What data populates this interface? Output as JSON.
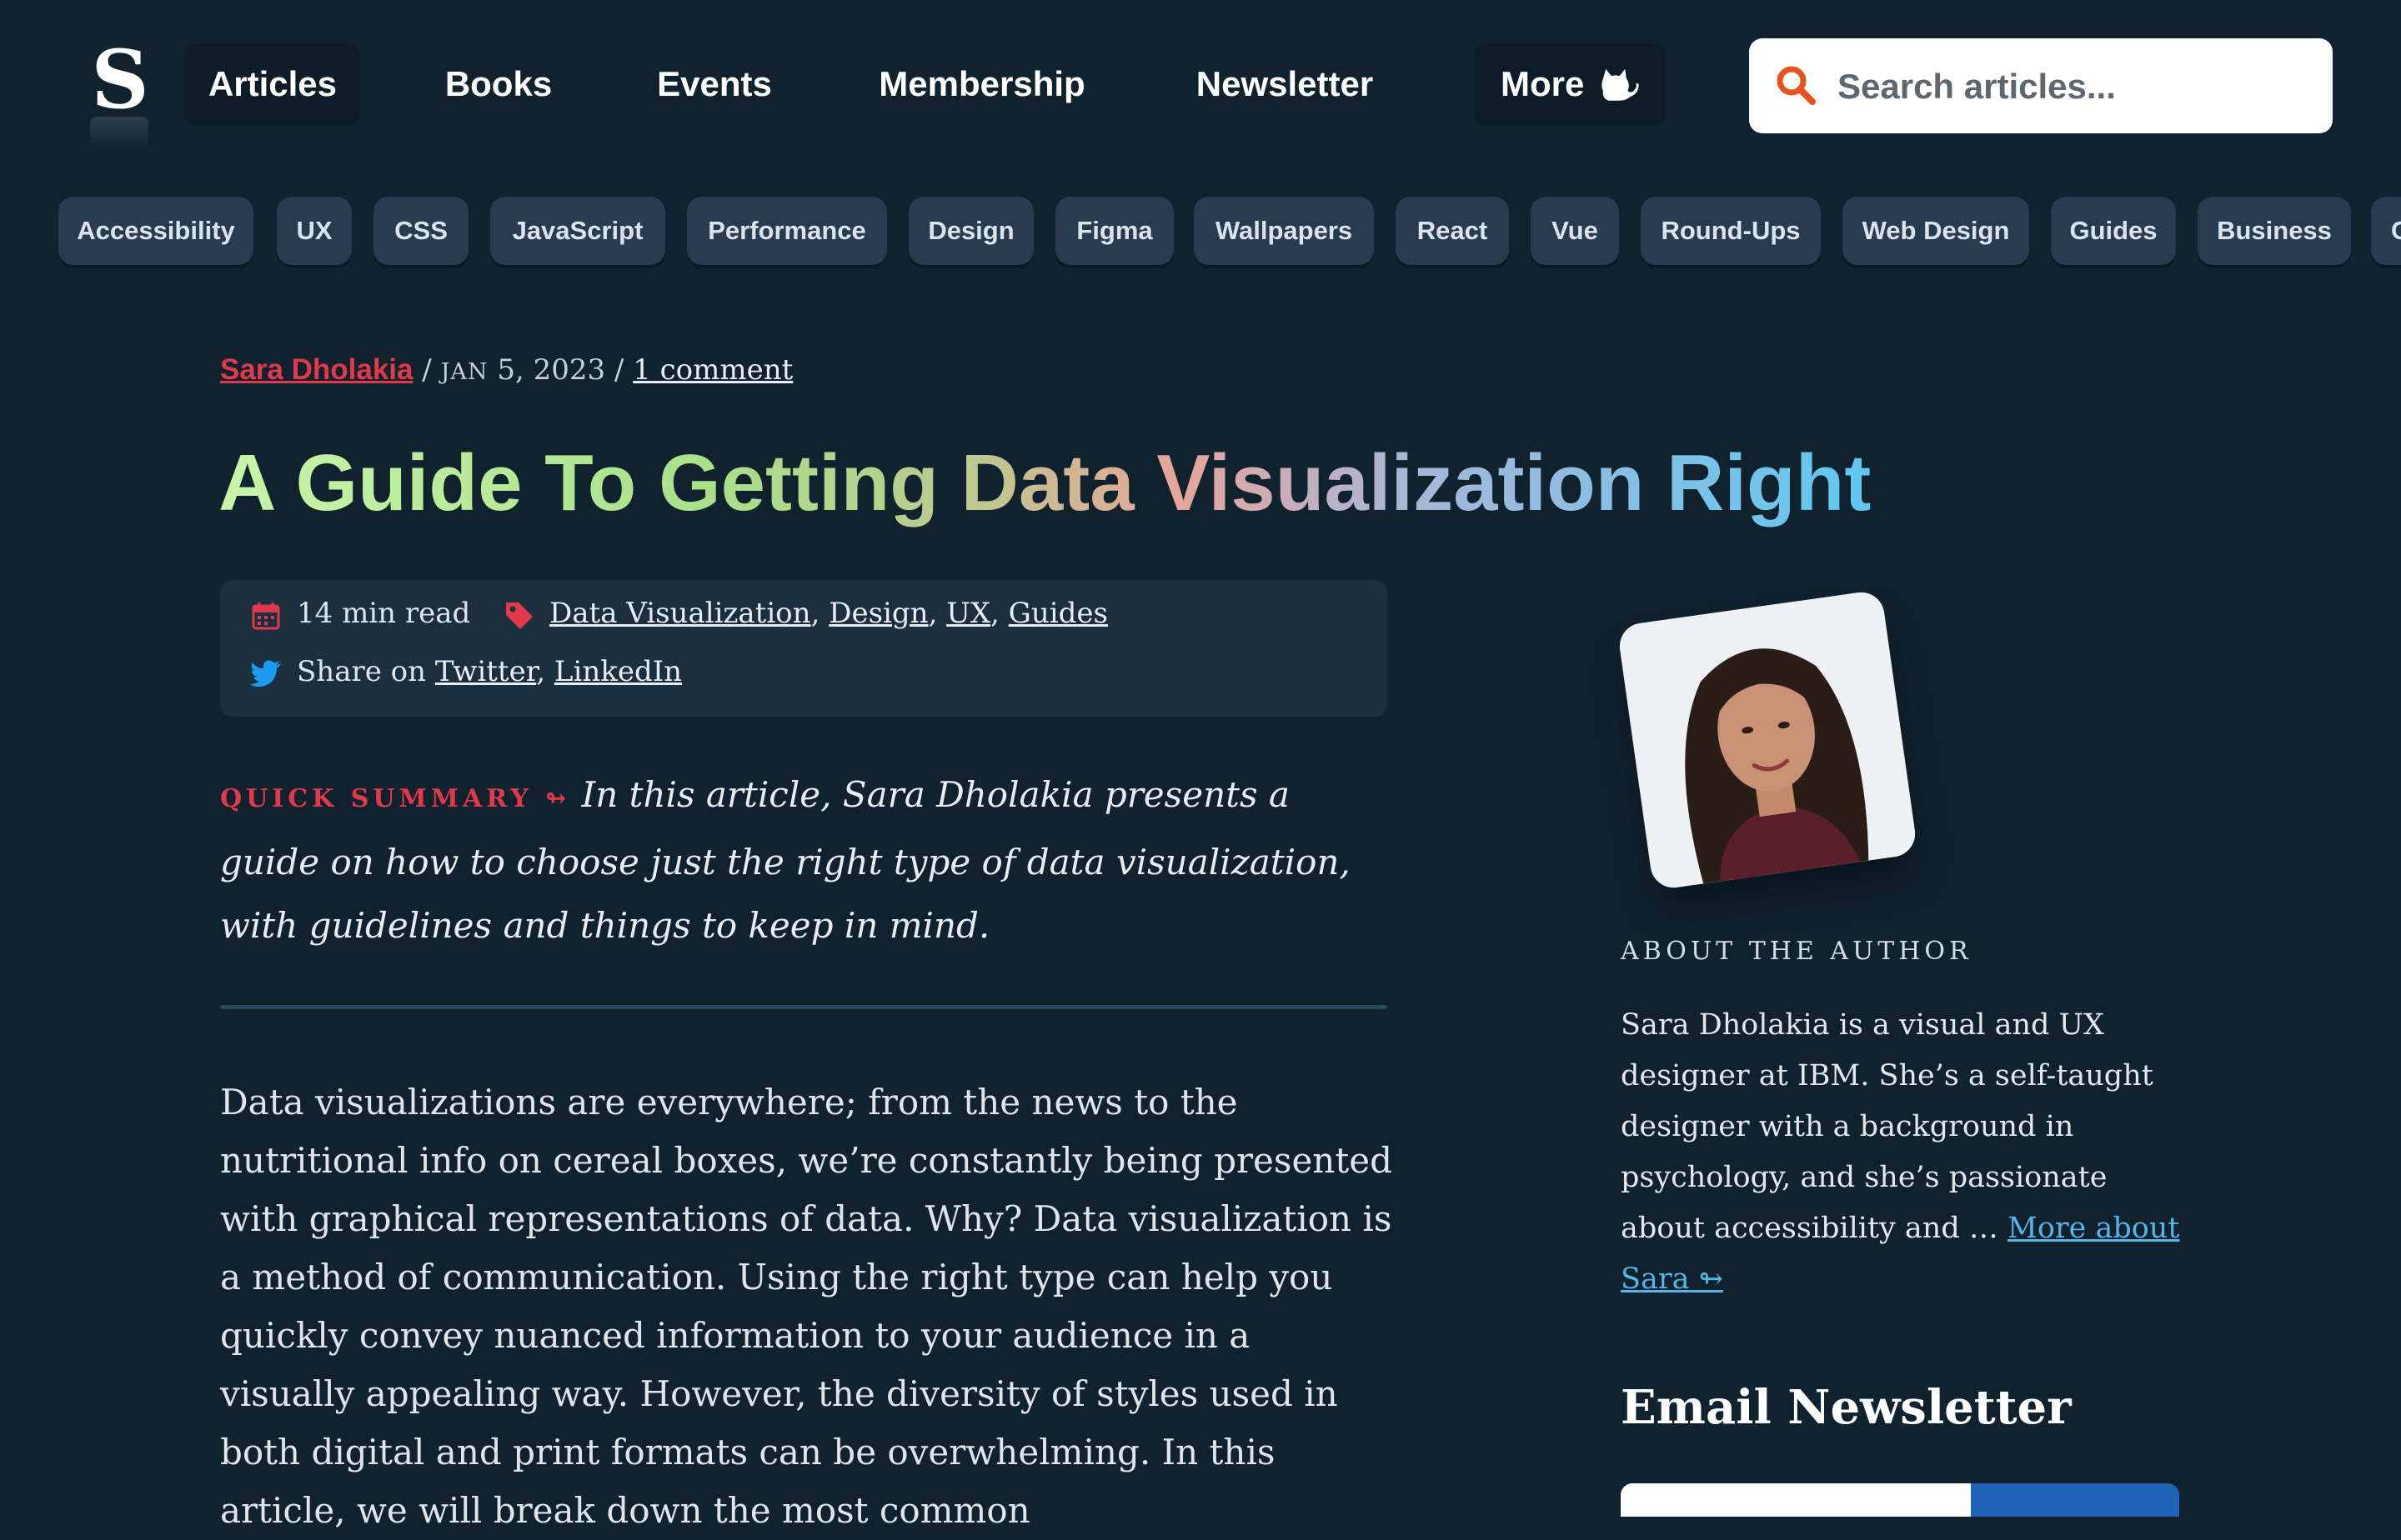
{
  "header": {
    "logo_text": "S",
    "nav": [
      {
        "label": "Articles"
      },
      {
        "label": "Books"
      },
      {
        "label": "Events"
      },
      {
        "label": "Membership"
      },
      {
        "label": "Newsletter"
      },
      {
        "label": "More",
        "icon": "cat-icon"
      }
    ],
    "search": {
      "placeholder": "Search articles...",
      "icon": "search-icon",
      "icon_color": "#e8531c"
    }
  },
  "tags": [
    "Accessibility",
    "UX",
    "CSS",
    "JavaScript",
    "Performance",
    "Design",
    "Figma",
    "Wallpapers",
    "React",
    "Vue",
    "Round-Ups",
    "Web Design",
    "Guides",
    "Business",
    "C"
  ],
  "article": {
    "author": "Sara Dholakia",
    "sep1": " / ",
    "date_month": "JAN",
    "date_rest": " 5, 2023",
    "sep2": " / ",
    "comments": "1 comment",
    "title": "A Guide To Getting Data Visualization Right",
    "read_time": "14 min read",
    "tags": [
      "Data Visualization",
      "Design",
      "UX",
      "Guides"
    ],
    "share_prefix": "Share on ",
    "share_links": [
      "Twitter",
      "LinkedIn"
    ],
    "summary_label": "QUICK SUMMARY ↬",
    "summary": "In this article, Sara Dholakia presents a guide on how to choose just the right type of data visualization, with guidelines and things to keep in mind.",
    "body": "Data visualizations are everywhere; from the news to the nutritional info on cereal boxes, we’re constantly being presented with graphical representations of data. Why? Data visualization is a method of communication. Using the right type can help you quickly convey nuanced information to your audience in a visually appealing way. However, the diversity of styles used in both digital and print formats can be overwhelming. In this article, we will break down the most common"
  },
  "sidebar": {
    "about_label": "ABOUT THE AUTHOR",
    "about_text": "Sara Dholakia is a visual and UX designer at IBM. She’s a self-taught designer with a background in psychology, and she’s passionate about accessibility and … ",
    "more_link": "More about Sara ↬",
    "newsletter_title": "Email Newsletter"
  },
  "colors": {
    "background": "#11222f",
    "accent_red": "#e0394c",
    "link_blue": "#58b4e6",
    "tag_bg": "#283c4f"
  }
}
